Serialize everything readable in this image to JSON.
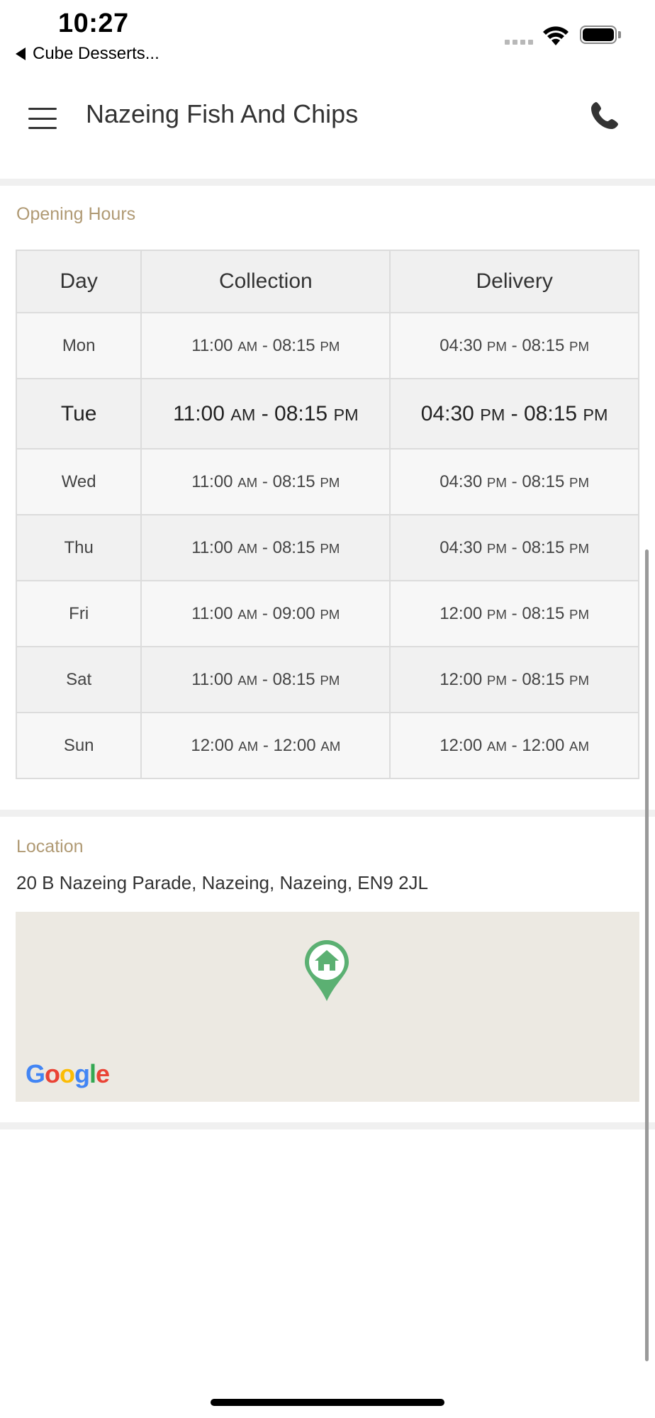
{
  "status_bar": {
    "time": "10:27",
    "back_app": "Cube Desserts..."
  },
  "header": {
    "title": "Nazeing Fish And Chips",
    "menu_icon": "hamburger-menu-icon",
    "phone_icon": "phone-icon"
  },
  "opening_hours": {
    "label": "Opening Hours",
    "columns": [
      "Day",
      "Collection",
      "Delivery"
    ],
    "rows": [
      {
        "day": "Mon",
        "collection": {
          "from": "11:00",
          "from_ampm": "AM",
          "to": "08:15",
          "to_ampm": "PM"
        },
        "delivery": {
          "from": "04:30",
          "from_ampm": "PM",
          "to": "08:15",
          "to_ampm": "PM"
        }
      },
      {
        "day": "Tue",
        "collection": {
          "from": "11:00",
          "from_ampm": "AM",
          "to": "08:15",
          "to_ampm": "PM"
        },
        "delivery": {
          "from": "04:30",
          "from_ampm": "PM",
          "to": "08:15",
          "to_ampm": "PM"
        }
      },
      {
        "day": "Wed",
        "collection": {
          "from": "11:00",
          "from_ampm": "AM",
          "to": "08:15",
          "to_ampm": "PM"
        },
        "delivery": {
          "from": "04:30",
          "from_ampm": "PM",
          "to": "08:15",
          "to_ampm": "PM"
        }
      },
      {
        "day": "Thu",
        "collection": {
          "from": "11:00",
          "from_ampm": "AM",
          "to": "08:15",
          "to_ampm": "PM"
        },
        "delivery": {
          "from": "04:30",
          "from_ampm": "PM",
          "to": "08:15",
          "to_ampm": "PM"
        }
      },
      {
        "day": "Fri",
        "collection": {
          "from": "11:00",
          "from_ampm": "AM",
          "to": "09:00",
          "to_ampm": "PM"
        },
        "delivery": {
          "from": "12:00",
          "from_ampm": "PM",
          "to": "08:15",
          "to_ampm": "PM"
        }
      },
      {
        "day": "Sat",
        "collection": {
          "from": "11:00",
          "from_ampm": "AM",
          "to": "08:15",
          "to_ampm": "PM"
        },
        "delivery": {
          "from": "12:00",
          "from_ampm": "PM",
          "to": "08:15",
          "to_ampm": "PM"
        }
      },
      {
        "day": "Sun",
        "collection": {
          "from": "12:00",
          "from_ampm": "AM",
          "to": "12:00",
          "to_ampm": "AM"
        },
        "delivery": {
          "from": "12:00",
          "from_ampm": "AM",
          "to": "12:00",
          "to_ampm": "AM"
        }
      }
    ],
    "highlighted_day": "Tue"
  },
  "location": {
    "label": "Location",
    "address": "20 B Nazeing Parade, Nazeing, Nazeing, EN9 2JL",
    "map_pin_icon": "home-map-pin-icon",
    "map_attribution": "Google"
  },
  "colors": {
    "accent_label": "#b09a74",
    "pin_green": "#5bb072",
    "divider": "#f0f0f0"
  }
}
